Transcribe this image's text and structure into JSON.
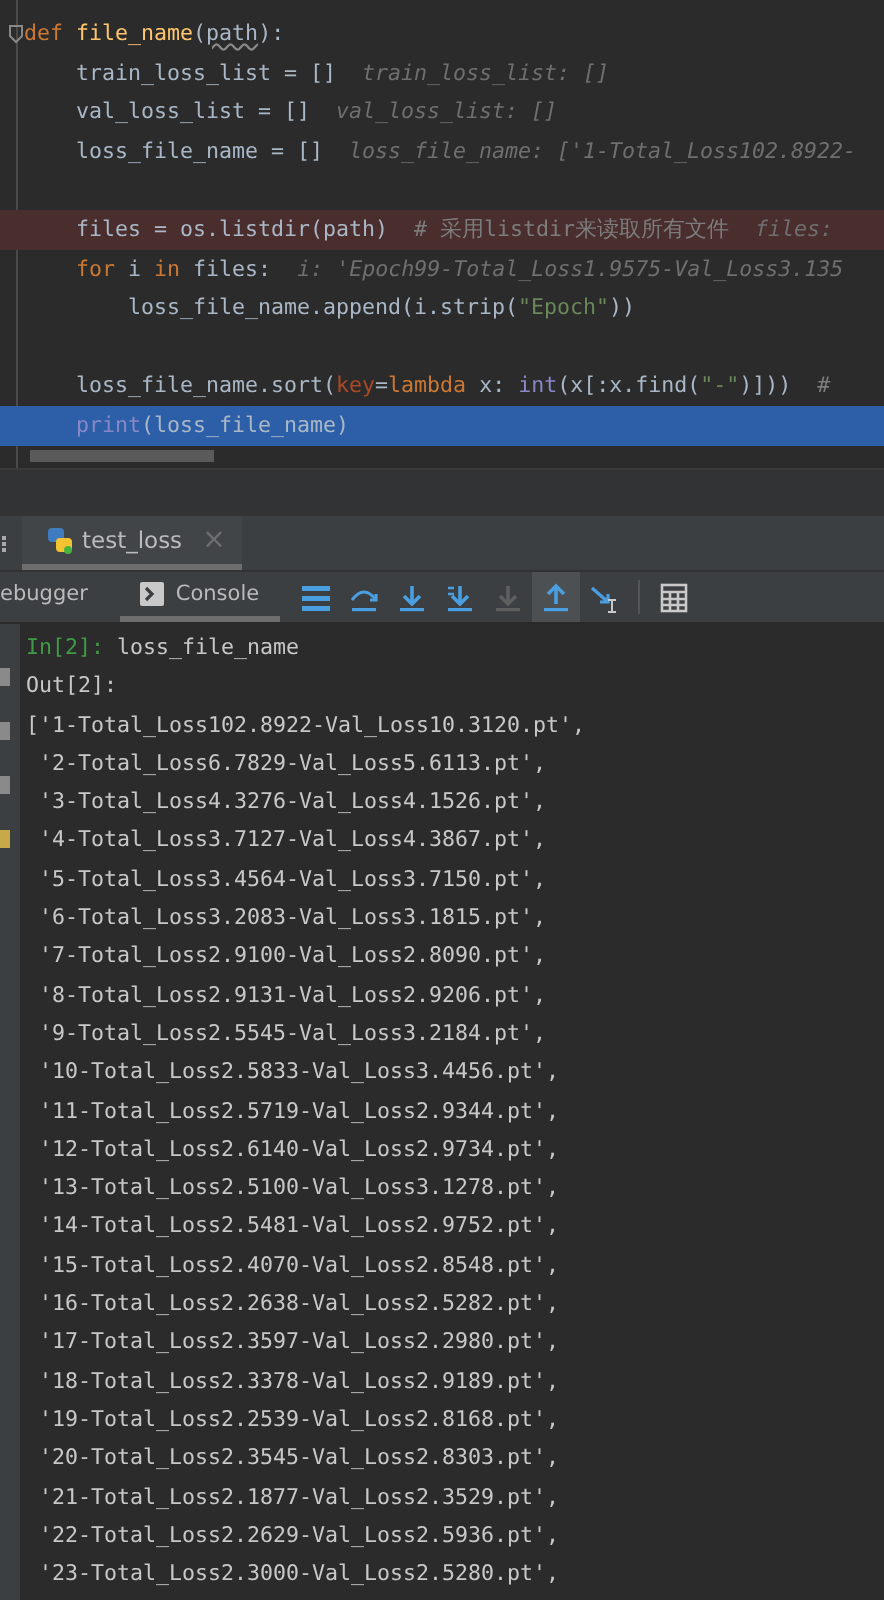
{
  "editor": {
    "lines": [
      {
        "kind": "normal",
        "tokens": [
          {
            "t": "def ",
            "kind": "keyword"
          },
          {
            "t": "file_name",
            "kind": "function"
          },
          {
            "t": "(",
            "kind": "plain"
          },
          {
            "t": "path",
            "kind": "param"
          },
          {
            "t": "):",
            "kind": "plain"
          }
        ],
        "children": [
          {
            "kind": "normal",
            "tokens": [
              {
                "t": "train_loss_list = []",
                "kind": "plain"
              },
              {
                "t": "  train_loss_list: []",
                "kind": "hint"
              }
            ]
          },
          {
            "kind": "normal",
            "tokens": [
              {
                "t": "val_loss_list = []",
                "kind": "plain"
              },
              {
                "t": "  val_loss_list: []",
                "kind": "hint"
              }
            ]
          },
          {
            "kind": "normal",
            "tokens": [
              {
                "t": "loss_file_name = []",
                "kind": "plain"
              },
              {
                "t": "  loss_file_name: ['1-Total_Loss102.8922-",
                "kind": "hint"
              }
            ]
          },
          {
            "kind": "blank"
          },
          {
            "kind": "breakpoint",
            "tokens": [
              {
                "t": "files = os.listdir(path)",
                "kind": "plain"
              },
              {
                "t": "  # 采用listdir来读取所有文件",
                "kind": "comment"
              },
              {
                "t": "  files:",
                "kind": "hint"
              }
            ]
          },
          {
            "kind": "normal",
            "tokens": [
              {
                "t": "for ",
                "kind": "keyword"
              },
              {
                "t": "i ",
                "kind": "plain"
              },
              {
                "t": "in ",
                "kind": "keyword"
              },
              {
                "t": "files:",
                "kind": "plain"
              },
              {
                "t": "  i: 'Epoch99-Total_Loss1.9575-Val_Loss3.135",
                "kind": "hint"
              }
            ],
            "children": [
              {
                "kind": "normal",
                "tokens": [
                  {
                    "t": "loss_file_name.append(i.strip(",
                    "kind": "plain"
                  },
                  {
                    "t": "\"Epoch\"",
                    "kind": "string"
                  },
                  {
                    "t": "))",
                    "kind": "plain"
                  }
                ]
              }
            ]
          },
          {
            "kind": "blank"
          },
          {
            "kind": "normal",
            "tokens": [
              {
                "t": "loss_file_name.sort(",
                "kind": "plain"
              },
              {
                "t": "key",
                "kind": "argname"
              },
              {
                "t": "=",
                "kind": "plain"
              },
              {
                "t": "lambda ",
                "kind": "keyword"
              },
              {
                "t": "x: ",
                "kind": "plain"
              },
              {
                "t": "int",
                "kind": "builtin"
              },
              {
                "t": "(x[:x.find(",
                "kind": "plain"
              },
              {
                "t": "\"-\"",
                "kind": "string"
              },
              {
                "t": ")]))",
                "kind": "plain"
              },
              {
                "t": "  #",
                "kind": "comment"
              }
            ]
          },
          {
            "kind": "current",
            "tokens": [
              {
                "t": "print",
                "kind": "builtin"
              },
              {
                "t": "(loss_file_name)",
                "kind": "plain"
              }
            ]
          }
        ]
      }
    ]
  },
  "run_tabs": [
    {
      "label": "test_loss",
      "close": "×",
      "selected": true
    }
  ],
  "toolbar": {
    "tabs": [
      {
        "label": "ebugger",
        "kind": "plain",
        "selected": false
      },
      {
        "label": "Console",
        "kind": "console",
        "selected": true
      }
    ],
    "buttons": [
      {
        "kind": "menu",
        "selected": false,
        "disabled": false
      },
      {
        "kind": "step-over",
        "selected": false,
        "disabled": false
      },
      {
        "kind": "step-into",
        "selected": false,
        "disabled": false
      },
      {
        "kind": "step-into-my",
        "selected": false,
        "disabled": false
      },
      {
        "kind": "force-step",
        "selected": false,
        "disabled": true
      },
      {
        "kind": "step-out",
        "selected": true,
        "disabled": false
      },
      {
        "kind": "run-to-cursor",
        "selected": false,
        "disabled": false
      },
      {
        "kind": "evaluate",
        "selected": false,
        "disabled": false
      }
    ]
  },
  "console": {
    "prompt": "In[2]:",
    "command": "loss_file_name",
    "out_label": "Out[2]:",
    "output": [
      "['1-Total_Loss102.8922-Val_Loss10.3120.pt',",
      "'2-Total_Loss6.7829-Val_Loss5.6113.pt',",
      "'3-Total_Loss4.3276-Val_Loss4.1526.pt',",
      "'4-Total_Loss3.7127-Val_Loss4.3867.pt',",
      "'5-Total_Loss3.4564-Val_Loss3.7150.pt',",
      "'6-Total_Loss3.2083-Val_Loss3.1815.pt',",
      "'7-Total_Loss2.9100-Val_Loss2.8090.pt',",
      "'8-Total_Loss2.9131-Val_Loss2.9206.pt',",
      "'9-Total_Loss2.5545-Val_Loss3.2184.pt',",
      "'10-Total_Loss2.5833-Val_Loss3.4456.pt',",
      "'11-Total_Loss2.5719-Val_Loss2.9344.pt',",
      "'12-Total_Loss2.6140-Val_Loss2.9734.pt',",
      "'13-Total_Loss2.5100-Val_Loss3.1278.pt',",
      "'14-Total_Loss2.5481-Val_Loss2.9752.pt',",
      "'15-Total_Loss2.4070-Val_Loss2.8548.pt',",
      "'16-Total_Loss2.2638-Val_Loss2.5282.pt',",
      "'17-Total_Loss2.3597-Val_Loss2.2980.pt',",
      "'18-Total_Loss2.3378-Val_Loss2.9189.pt',",
      "'19-Total_Loss2.2539-Val_Loss2.8168.pt',",
      "'20-Total_Loss2.3545-Val_Loss2.8303.pt',",
      "'21-Total_Loss2.1877-Val_Loss2.3529.pt',",
      "'22-Total_Loss2.2629-Val_Loss2.5936.pt',",
      "'23-Total_Loss2.3000-Val_Loss2.5280.pt',"
    ]
  }
}
